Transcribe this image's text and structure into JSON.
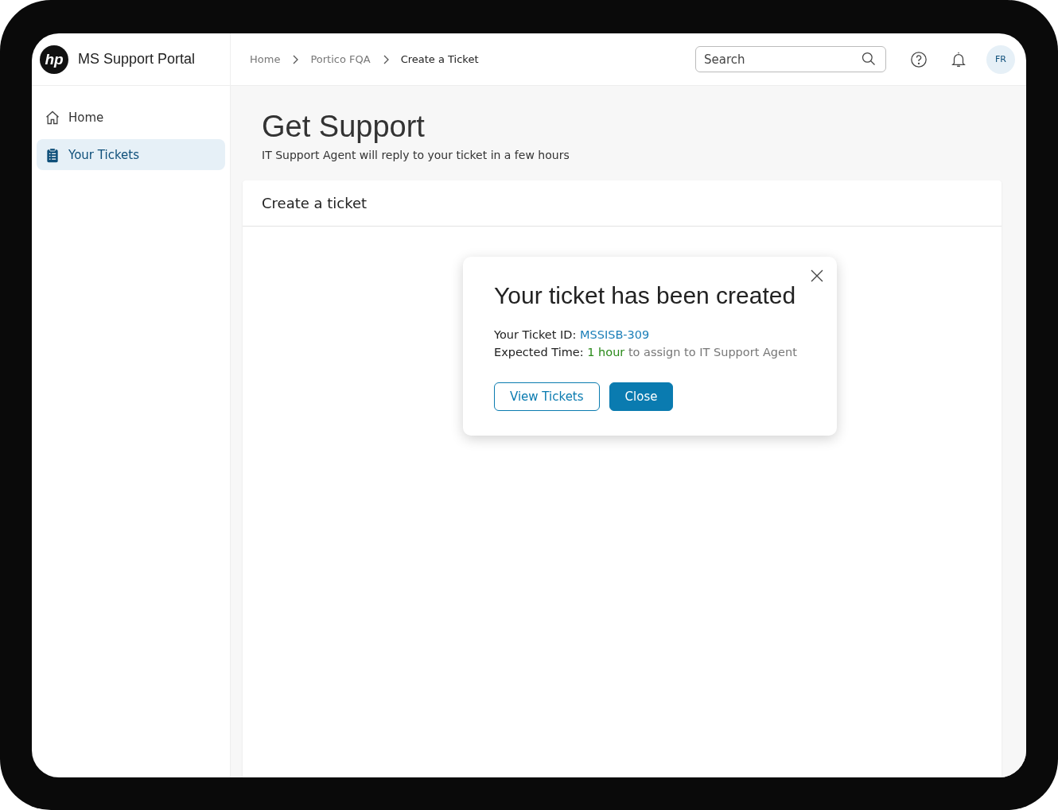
{
  "brand": {
    "logo_text": "hp",
    "title": "MS Support Portal"
  },
  "sidebar": {
    "items": [
      {
        "label": "Home",
        "kind": "home",
        "selected": false
      },
      {
        "label": "Your Tickets",
        "kind": "tickets",
        "selected": true
      }
    ]
  },
  "breadcrumbs": [
    {
      "label": "Home",
      "current": false
    },
    {
      "label": "Portico FQA",
      "current": false
    },
    {
      "label": "Create a Ticket",
      "current": true
    }
  ],
  "search": {
    "placeholder": "Search"
  },
  "avatar": {
    "initials": "FR"
  },
  "page": {
    "title": "Get Support",
    "subtitle": "IT Support Agent will reply to your ticket in a few hours"
  },
  "card": {
    "title": "Create a ticket"
  },
  "dialog": {
    "title": "Your ticket has been created",
    "ticket_line": {
      "label": "Your Ticket ID:",
      "id": "MSSISB-309"
    },
    "time_line": {
      "label": "Expected Time:",
      "highlight": "1 hour",
      "rest": "to assign to IT Support Agent"
    },
    "buttons": [
      {
        "label": "View Tickets",
        "kind": "outline"
      },
      {
        "label": "Close",
        "kind": "primary"
      }
    ]
  }
}
